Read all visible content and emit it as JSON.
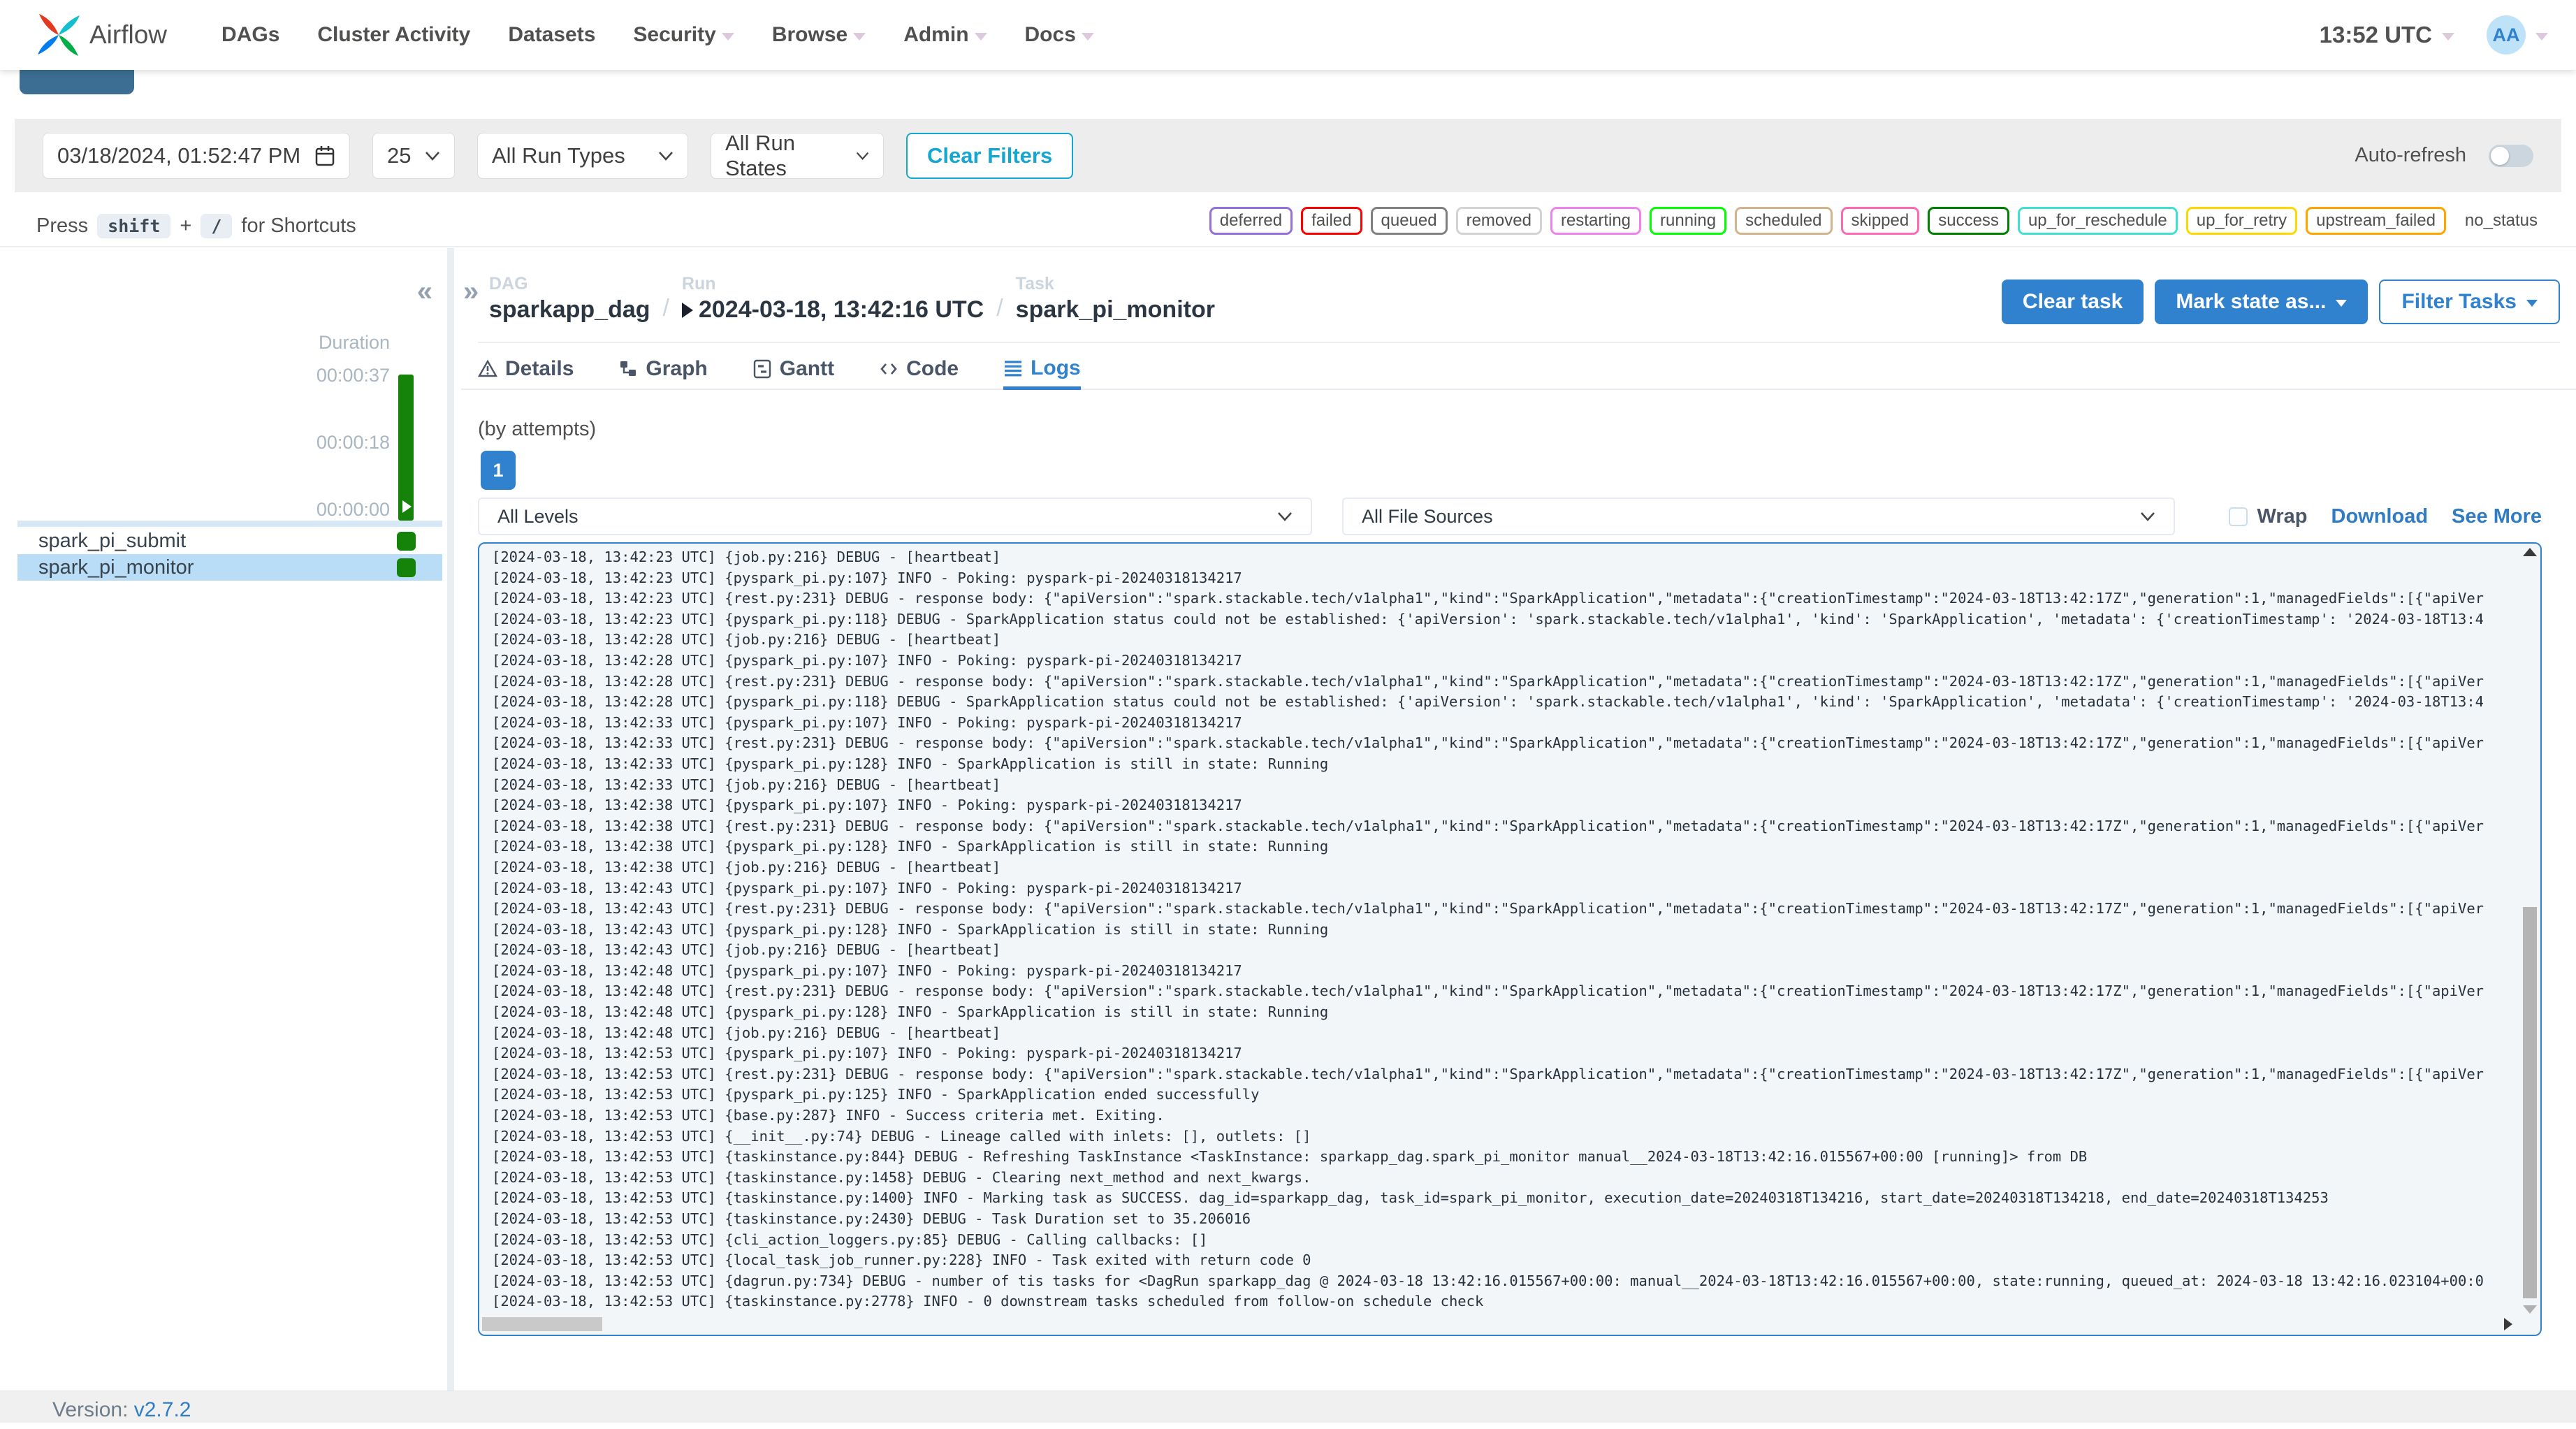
{
  "navbar": {
    "brand": "Airflow",
    "items": [
      {
        "label": "DAGs",
        "has_caret": false
      },
      {
        "label": "Cluster Activity",
        "has_caret": false
      },
      {
        "label": "Datasets",
        "has_caret": false
      },
      {
        "label": "Security",
        "has_caret": true
      },
      {
        "label": "Browse",
        "has_caret": true
      },
      {
        "label": "Admin",
        "has_caret": true
      },
      {
        "label": "Docs",
        "has_caret": true
      }
    ],
    "clock": "13:52 UTC",
    "avatar": "AA"
  },
  "filter_bar": {
    "datetime": "03/18/2024, 01:52:47 PM",
    "page_size": "25",
    "run_types": "All Run Types",
    "run_states": "All Run States",
    "clear_filters": "Clear Filters",
    "auto_refresh": "Auto-refresh"
  },
  "shortcut_hint": {
    "prefix": "Press",
    "key_shift": "shift",
    "plus": "+",
    "key_slash": "/",
    "suffix": "for Shortcuts"
  },
  "state_legend": [
    {
      "label": "deferred",
      "color": "#9370DB"
    },
    {
      "label": "failed",
      "color": "#FF0000"
    },
    {
      "label": "queued",
      "color": "#808080"
    },
    {
      "label": "removed",
      "color": "#D3D3D3"
    },
    {
      "label": "restarting",
      "color": "#EE82EE"
    },
    {
      "label": "running",
      "color": "#00FF00"
    },
    {
      "label": "scheduled",
      "color": "#D2B48C"
    },
    {
      "label": "skipped",
      "color": "#FF69B4"
    },
    {
      "label": "success",
      "color": "#008000"
    },
    {
      "label": "up_for_reschedule",
      "color": "#40E0D0"
    },
    {
      "label": "up_for_retry",
      "color": "#FFD700"
    },
    {
      "label": "upstream_failed",
      "color": "#FFA500"
    },
    {
      "label": "no_status",
      "color": "transparent"
    }
  ],
  "breadcrumb": {
    "dag_label": "DAG",
    "dag": "sparkapp_dag",
    "run_label": "Run",
    "run": "2024-03-18, 13:42:16 UTC",
    "task_label": "Task",
    "task": "spark_pi_monitor",
    "separator": "/"
  },
  "task_actions": {
    "clear": "Clear task",
    "mark_state": "Mark state as...",
    "filter_tasks": "Filter Tasks"
  },
  "tabs": [
    {
      "label": "Details"
    },
    {
      "label": "Graph"
    },
    {
      "label": "Gantt"
    },
    {
      "label": "Code"
    },
    {
      "label": "Logs"
    }
  ],
  "sidebar": {
    "duration_label": "Duration",
    "ticks": [
      "00:00:37",
      "00:00:18",
      "00:00:00"
    ],
    "tasks": [
      {
        "name": "spark_pi_submit",
        "selected": false
      },
      {
        "name": "spark_pi_monitor",
        "selected": true
      }
    ],
    "bar_color": "#15830a",
    "selected_row_color": "#b9ddf6"
  },
  "logs": {
    "attempts_label": "(by attempts)",
    "attempt": "1",
    "level_filter": "All Levels",
    "source_filter": "All File Sources",
    "wrap_label": "Wrap",
    "download_label": "Download",
    "see_more_label": "See More",
    "lines": [
      "[2024-03-18, 13:42:23 UTC] {job.py:216} DEBUG - [heartbeat]",
      "[2024-03-18, 13:42:23 UTC] {pyspark_pi.py:107} INFO - Poking: pyspark-pi-20240318134217",
      "[2024-03-18, 13:42:23 UTC] {rest.py:231} DEBUG - response body: {\"apiVersion\":\"spark.stackable.tech/v1alpha1\",\"kind\":\"SparkApplication\",\"metadata\":{\"creationTimestamp\":\"2024-03-18T13:42:17Z\",\"generation\":1,\"managedFields\":[{\"apiVer",
      "[2024-03-18, 13:42:23 UTC] {pyspark_pi.py:118} DEBUG - SparkApplication status could not be established: {'apiVersion': 'spark.stackable.tech/v1alpha1', 'kind': 'SparkApplication', 'metadata': {'creationTimestamp': '2024-03-18T13:4",
      "[2024-03-18, 13:42:28 UTC] {job.py:216} DEBUG - [heartbeat]",
      "[2024-03-18, 13:42:28 UTC] {pyspark_pi.py:107} INFO - Poking: pyspark-pi-20240318134217",
      "[2024-03-18, 13:42:28 UTC] {rest.py:231} DEBUG - response body: {\"apiVersion\":\"spark.stackable.tech/v1alpha1\",\"kind\":\"SparkApplication\",\"metadata\":{\"creationTimestamp\":\"2024-03-18T13:42:17Z\",\"generation\":1,\"managedFields\":[{\"apiVer",
      "[2024-03-18, 13:42:28 UTC] {pyspark_pi.py:118} DEBUG - SparkApplication status could not be established: {'apiVersion': 'spark.stackable.tech/v1alpha1', 'kind': 'SparkApplication', 'metadata': {'creationTimestamp': '2024-03-18T13:4",
      "[2024-03-18, 13:42:33 UTC] {pyspark_pi.py:107} INFO - Poking: pyspark-pi-20240318134217",
      "[2024-03-18, 13:42:33 UTC] {rest.py:231} DEBUG - response body: {\"apiVersion\":\"spark.stackable.tech/v1alpha1\",\"kind\":\"SparkApplication\",\"metadata\":{\"creationTimestamp\":\"2024-03-18T13:42:17Z\",\"generation\":1,\"managedFields\":[{\"apiVer",
      "[2024-03-18, 13:42:33 UTC] {pyspark_pi.py:128} INFO - SparkApplication is still in state: Running",
      "[2024-03-18, 13:42:33 UTC] {job.py:216} DEBUG - [heartbeat]",
      "[2024-03-18, 13:42:38 UTC] {pyspark_pi.py:107} INFO - Poking: pyspark-pi-20240318134217",
      "[2024-03-18, 13:42:38 UTC] {rest.py:231} DEBUG - response body: {\"apiVersion\":\"spark.stackable.tech/v1alpha1\",\"kind\":\"SparkApplication\",\"metadata\":{\"creationTimestamp\":\"2024-03-18T13:42:17Z\",\"generation\":1,\"managedFields\":[{\"apiVer",
      "[2024-03-18, 13:42:38 UTC] {pyspark_pi.py:128} INFO - SparkApplication is still in state: Running",
      "[2024-03-18, 13:42:38 UTC] {job.py:216} DEBUG - [heartbeat]",
      "[2024-03-18, 13:42:43 UTC] {pyspark_pi.py:107} INFO - Poking: pyspark-pi-20240318134217",
      "[2024-03-18, 13:42:43 UTC] {rest.py:231} DEBUG - response body: {\"apiVersion\":\"spark.stackable.tech/v1alpha1\",\"kind\":\"SparkApplication\",\"metadata\":{\"creationTimestamp\":\"2024-03-18T13:42:17Z\",\"generation\":1,\"managedFields\":[{\"apiVer",
      "[2024-03-18, 13:42:43 UTC] {pyspark_pi.py:128} INFO - SparkApplication is still in state: Running",
      "[2024-03-18, 13:42:43 UTC] {job.py:216} DEBUG - [heartbeat]",
      "[2024-03-18, 13:42:48 UTC] {pyspark_pi.py:107} INFO - Poking: pyspark-pi-20240318134217",
      "[2024-03-18, 13:42:48 UTC] {rest.py:231} DEBUG - response body: {\"apiVersion\":\"spark.stackable.tech/v1alpha1\",\"kind\":\"SparkApplication\",\"metadata\":{\"creationTimestamp\":\"2024-03-18T13:42:17Z\",\"generation\":1,\"managedFields\":[{\"apiVer",
      "[2024-03-18, 13:42:48 UTC] {pyspark_pi.py:128} INFO - SparkApplication is still in state: Running",
      "[2024-03-18, 13:42:48 UTC] {job.py:216} DEBUG - [heartbeat]",
      "[2024-03-18, 13:42:53 UTC] {pyspark_pi.py:107} INFO - Poking: pyspark-pi-20240318134217",
      "[2024-03-18, 13:42:53 UTC] {rest.py:231} DEBUG - response body: {\"apiVersion\":\"spark.stackable.tech/v1alpha1\",\"kind\":\"SparkApplication\",\"metadata\":{\"creationTimestamp\":\"2024-03-18T13:42:17Z\",\"generation\":1,\"managedFields\":[{\"apiVer",
      "[2024-03-18, 13:42:53 UTC] {pyspark_pi.py:125} INFO - SparkApplication ended successfully",
      "[2024-03-18, 13:42:53 UTC] {base.py:287} INFO - Success criteria met. Exiting.",
      "[2024-03-18, 13:42:53 UTC] {__init__.py:74} DEBUG - Lineage called with inlets: [], outlets: []",
      "[2024-03-18, 13:42:53 UTC] {taskinstance.py:844} DEBUG - Refreshing TaskInstance <TaskInstance: sparkapp_dag.spark_pi_monitor manual__2024-03-18T13:42:16.015567+00:00 [running]> from DB",
      "[2024-03-18, 13:42:53 UTC] {taskinstance.py:1458} DEBUG - Clearing next_method and next_kwargs.",
      "[2024-03-18, 13:42:53 UTC] {taskinstance.py:1400} INFO - Marking task as SUCCESS. dag_id=sparkapp_dag, task_id=spark_pi_monitor, execution_date=20240318T134216, start_date=20240318T134218, end_date=20240318T134253",
      "[2024-03-18, 13:42:53 UTC] {taskinstance.py:2430} DEBUG - Task Duration set to 35.206016",
      "[2024-03-18, 13:42:53 UTC] {cli_action_loggers.py:85} DEBUG - Calling callbacks: []",
      "[2024-03-18, 13:42:53 UTC] {local_task_job_runner.py:228} INFO - Task exited with return code 0",
      "[2024-03-18, 13:42:53 UTC] {dagrun.py:734} DEBUG - number of tis tasks for <DagRun sparkapp_dag @ 2024-03-18 13:42:16.015567+00:00: manual__2024-03-18T13:42:16.015567+00:00, state:running, queued_at: 2024-03-18 13:42:16.023104+00:0",
      "[2024-03-18, 13:42:53 UTC] {taskinstance.py:2778} INFO - 0 downstream tasks scheduled from follow-on schedule check"
    ]
  },
  "footer": {
    "version_label": "Version:",
    "version": "v2.7.2"
  },
  "colors": {
    "accent_blue": "#3182ce",
    "cyan_accent": "#16a7d0",
    "success_green": "#15830a",
    "selected_row": "#b9ddf6",
    "avatar_bg": "#bee3f8"
  }
}
